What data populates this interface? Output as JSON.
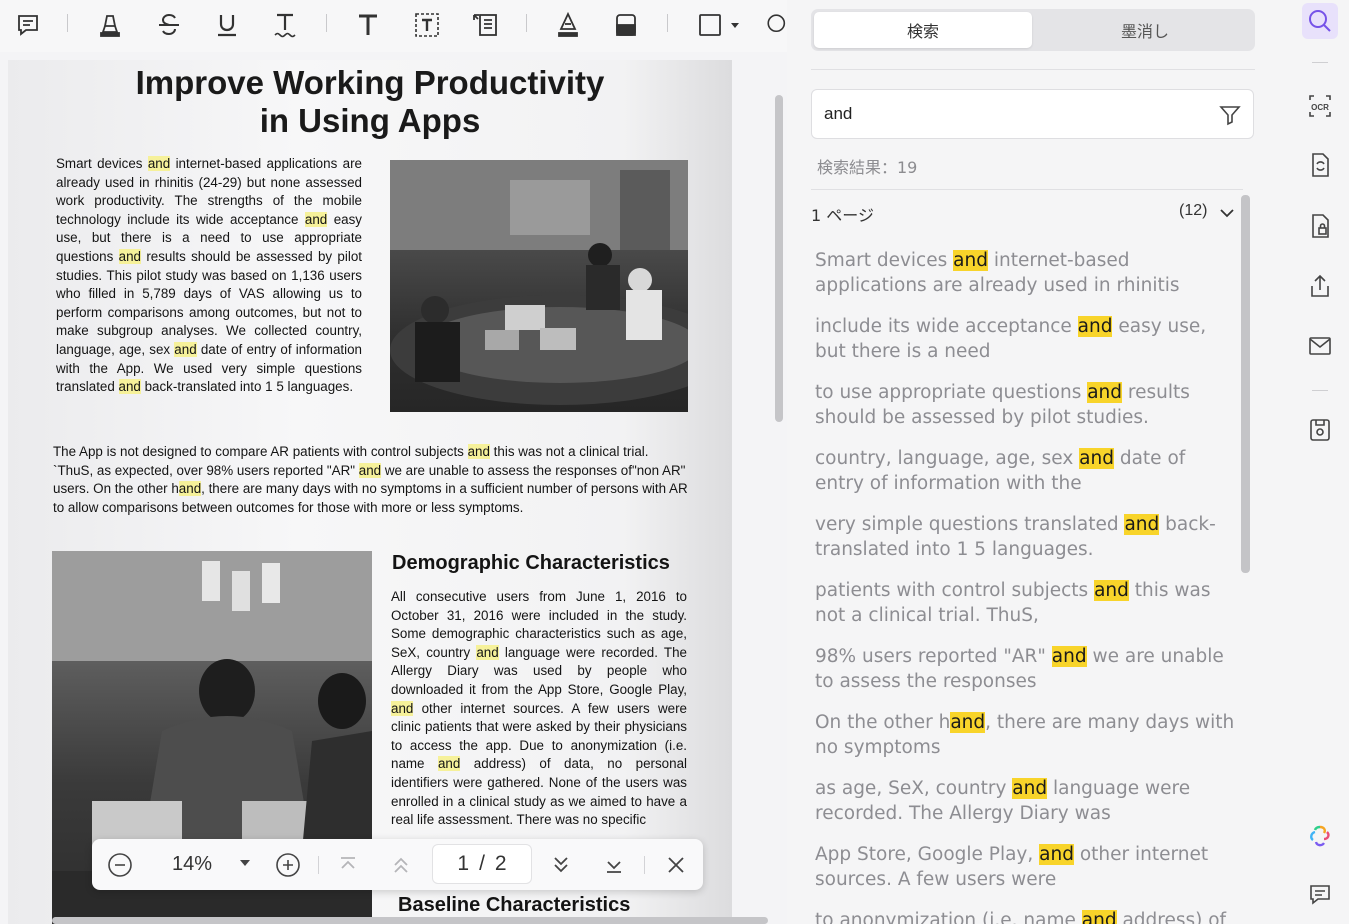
{
  "toolbar": {
    "tools": [
      {
        "name": "comment-icon"
      },
      {
        "name": "highlight-icon"
      },
      {
        "name": "strikethrough-icon"
      },
      {
        "name": "underline-icon"
      },
      {
        "name": "squiggly-underline-icon"
      },
      {
        "name": "text-icon"
      },
      {
        "name": "text-box-icon"
      },
      {
        "name": "text-callout-icon"
      },
      {
        "name": "pencil-icon"
      },
      {
        "name": "eraser-icon"
      },
      {
        "name": "shape-rectangle-icon"
      },
      {
        "name": "lasso-icon"
      }
    ]
  },
  "document": {
    "title_line1": "Improve Working Productivity",
    "title_line2": "in Using Apps",
    "intro_paragraph": [
      {
        "t": "Smart devices "
      },
      {
        "t": "and",
        "h": true
      },
      {
        "t": " internet-based applications are already used in rhinitis (24-29) but none assessed work productivity. The strengths of the mobile technology include its wide acceptance "
      },
      {
        "t": "and",
        "h": true
      },
      {
        "t": " easy use, but there is a need to use appropriate questions "
      },
      {
        "t": "and",
        "h": true
      },
      {
        "t": " results should be assessed by pilot studies. This pilot study was based on 1,136 users who filled in 5,789 days of VAS allowing us to perform comparisons among outcomes, but not to make subgroup analyses. We collected country, language, age, sex "
      },
      {
        "t": "and",
        "h": true
      },
      {
        "t": " date of entry of information with the App. We used very simple questions translated "
      },
      {
        "t": "and",
        "h": true
      },
      {
        "t": " back-translated into 1 5 languages."
      }
    ],
    "second_paragraph": [
      {
        "t": "The App is not designed to compare AR patients with control subjects "
      },
      {
        "t": "and",
        "h": true
      },
      {
        "t": " this was not a clinical trial. `ThuS, as expected, over 98% users reported \"AR\" "
      },
      {
        "t": "and",
        "h": true
      },
      {
        "t": " we are unable to assess the responses of\"non AR\" users. On the other h"
      },
      {
        "t": "and",
        "h": true
      },
      {
        "t": ", there are many days with no symptoms in a sufficient number of persons with AR to allow comparisons between outcomes for those with more or less symptoms."
      }
    ],
    "section1_heading": "Demographic Characteristics",
    "section1_paragraph": [
      {
        "t": "All consecutive users from June 1, 2016 to October 31, 2016 were included in the study. Some demographic characteristics such as age, SeX, country "
      },
      {
        "t": "and",
        "h": true
      },
      {
        "t": " language were recorded. The Allergy Diary was used by people who downloaded it from the App Store, Google Play, "
      },
      {
        "t": "and",
        "h": true
      },
      {
        "t": " other internet sources. A few users were clinic patients that were asked by their physicians to access the app. Due to anonymization (i.e. name "
      },
      {
        "t": "and",
        "h": true
      },
      {
        "t": " address) of data, no personal identifiers were gathered. None of the users was enrolled in a clinical study as we aimed to have a real life assessment. There was no specific"
      }
    ],
    "section2_heading": "Baseline Characteristics"
  },
  "navigator": {
    "zoom": "14%",
    "page_current": "1",
    "page_separator": "/",
    "page_total": "2"
  },
  "panel": {
    "tab_search": "検索",
    "tab_redact": "墨消し",
    "search_value": "and",
    "result_count_label": "検索結果：19",
    "group_label": "1 ページ",
    "group_count": "(12)",
    "results": [
      [
        {
          "t": "Smart devices "
        },
        {
          "t": "and",
          "m": true
        },
        {
          "t": " internet-based applications are already used in rhinitis"
        }
      ],
      [
        {
          "t": "include its wide acceptance "
        },
        {
          "t": "and",
          "m": true
        },
        {
          "t": " easy use, but there is a need"
        }
      ],
      [
        {
          "t": "to use appropriate questions "
        },
        {
          "t": "and",
          "m": true
        },
        {
          "t": " results should be assessed by pilot studies."
        }
      ],
      [
        {
          "t": "country, language, age, sex "
        },
        {
          "t": "and",
          "m": true
        },
        {
          "t": " date of entry of information with the"
        }
      ],
      [
        {
          "t": "very simple questions translated "
        },
        {
          "t": "and",
          "m": true
        },
        {
          "t": " back-translated into 1 5 languages."
        }
      ],
      [
        {
          "t": "patients with control subjects "
        },
        {
          "t": "and",
          "m": true
        },
        {
          "t": " this was not a clinical trial. ThuS,"
        }
      ],
      [
        {
          "t": "98% users reported \"AR\" "
        },
        {
          "t": "and",
          "m": true
        },
        {
          "t": " we are unable to assess the responses"
        }
      ],
      [
        {
          "t": "On the other h"
        },
        {
          "t": "and",
          "m": true
        },
        {
          "t": ", there are many days with no symptoms"
        }
      ],
      [
        {
          "t": "as age, SeX, country "
        },
        {
          "t": "and",
          "m": true
        },
        {
          "t": " language were recorded. The Allergy Diary was"
        }
      ],
      [
        {
          "t": "App Store, Google Play, "
        },
        {
          "t": "and",
          "m": true
        },
        {
          "t": " other internet sources. A few users were"
        }
      ],
      [
        {
          "t": "to anonymization (i.e. name "
        },
        {
          "t": "and",
          "m": true
        },
        {
          "t": " address) of"
        }
      ]
    ]
  },
  "rail": {
    "items": [
      {
        "name": "search-icon",
        "active": true
      },
      {
        "name": "ocr-icon"
      },
      {
        "name": "convert-icon"
      },
      {
        "name": "protect-icon"
      },
      {
        "name": "share-icon"
      },
      {
        "name": "mail-icon"
      },
      {
        "name": "save-icon"
      },
      {
        "name": "ai-assistant-icon"
      },
      {
        "name": "comments-list-icon"
      }
    ],
    "ocr_label": "OCR"
  }
}
